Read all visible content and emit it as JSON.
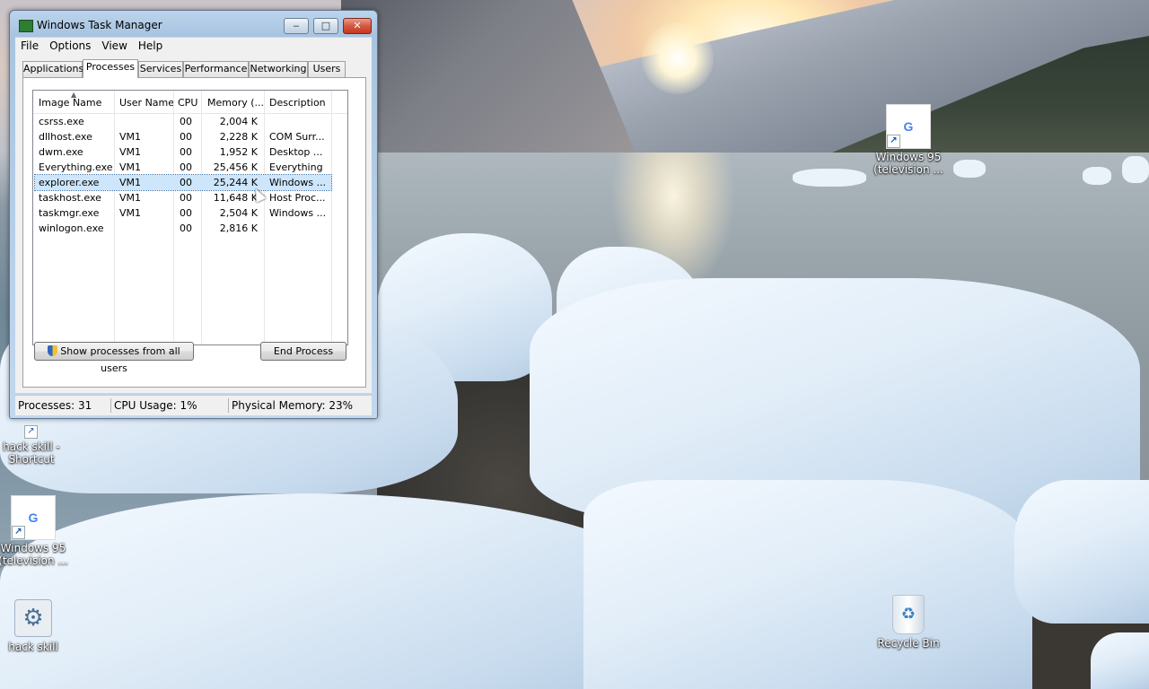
{
  "window": {
    "title": "Windows Task Manager",
    "min_glyph": "‒",
    "max_glyph": "□",
    "close_glyph": "✕"
  },
  "menu": [
    "File",
    "Options",
    "View",
    "Help"
  ],
  "tabs": [
    "Applications",
    "Processes",
    "Services",
    "Performance",
    "Networking",
    "Users"
  ],
  "active_tab": "Processes",
  "columns": [
    "Image Name",
    "User Name",
    "CPU",
    "Memory (...",
    "Description"
  ],
  "rows": [
    {
      "image": "csrss.exe",
      "user": "",
      "cpu": "00",
      "memory": "2,004 K",
      "desc": ""
    },
    {
      "image": "dllhost.exe",
      "user": "VM1",
      "cpu": "00",
      "memory": "2,228 K",
      "desc": "COM Surr..."
    },
    {
      "image": "dwm.exe",
      "user": "VM1",
      "cpu": "00",
      "memory": "1,952 K",
      "desc": "Desktop ..."
    },
    {
      "image": "Everything.exe",
      "user": "VM1",
      "cpu": "00",
      "memory": "25,456 K",
      "desc": "Everything"
    },
    {
      "image": "explorer.exe",
      "user": "VM1",
      "cpu": "00",
      "memory": "25,244 K",
      "desc": "Windows ..."
    },
    {
      "image": "taskhost.exe",
      "user": "VM1",
      "cpu": "00",
      "memory": "11,648 K",
      "desc": "Host Proc..."
    },
    {
      "image": "taskmgr.exe",
      "user": "VM1",
      "cpu": "00",
      "memory": "2,504 K",
      "desc": "Windows ..."
    },
    {
      "image": "winlogon.exe",
      "user": "",
      "cpu": "00",
      "memory": "2,816 K",
      "desc": ""
    }
  ],
  "selected_row": 4,
  "buttons": {
    "show_all": "Show processes from all users",
    "end_process": "End Process"
  },
  "status": {
    "processes": "Processes: 31",
    "cpu": "CPU Usage: 1%",
    "memory": "Physical Memory: 23%"
  },
  "desktop_icons": {
    "chrome_top": {
      "label1": "Windows 95",
      "label2": "(television ...",
      "glyph": "G"
    },
    "hack_skill_shortcut": {
      "label1": "hack skill -",
      "label2": "Shortcut"
    },
    "chrome_left": {
      "label1": "Windows 95",
      "label2": "(television ...",
      "glyph": "G"
    },
    "hack_skill": {
      "label1": "hack skill",
      "glyph": "⚙"
    },
    "recycle_bin": {
      "label1": "Recycle Bin",
      "glyph": "♻"
    }
  },
  "shortcut_glyph": "↗"
}
